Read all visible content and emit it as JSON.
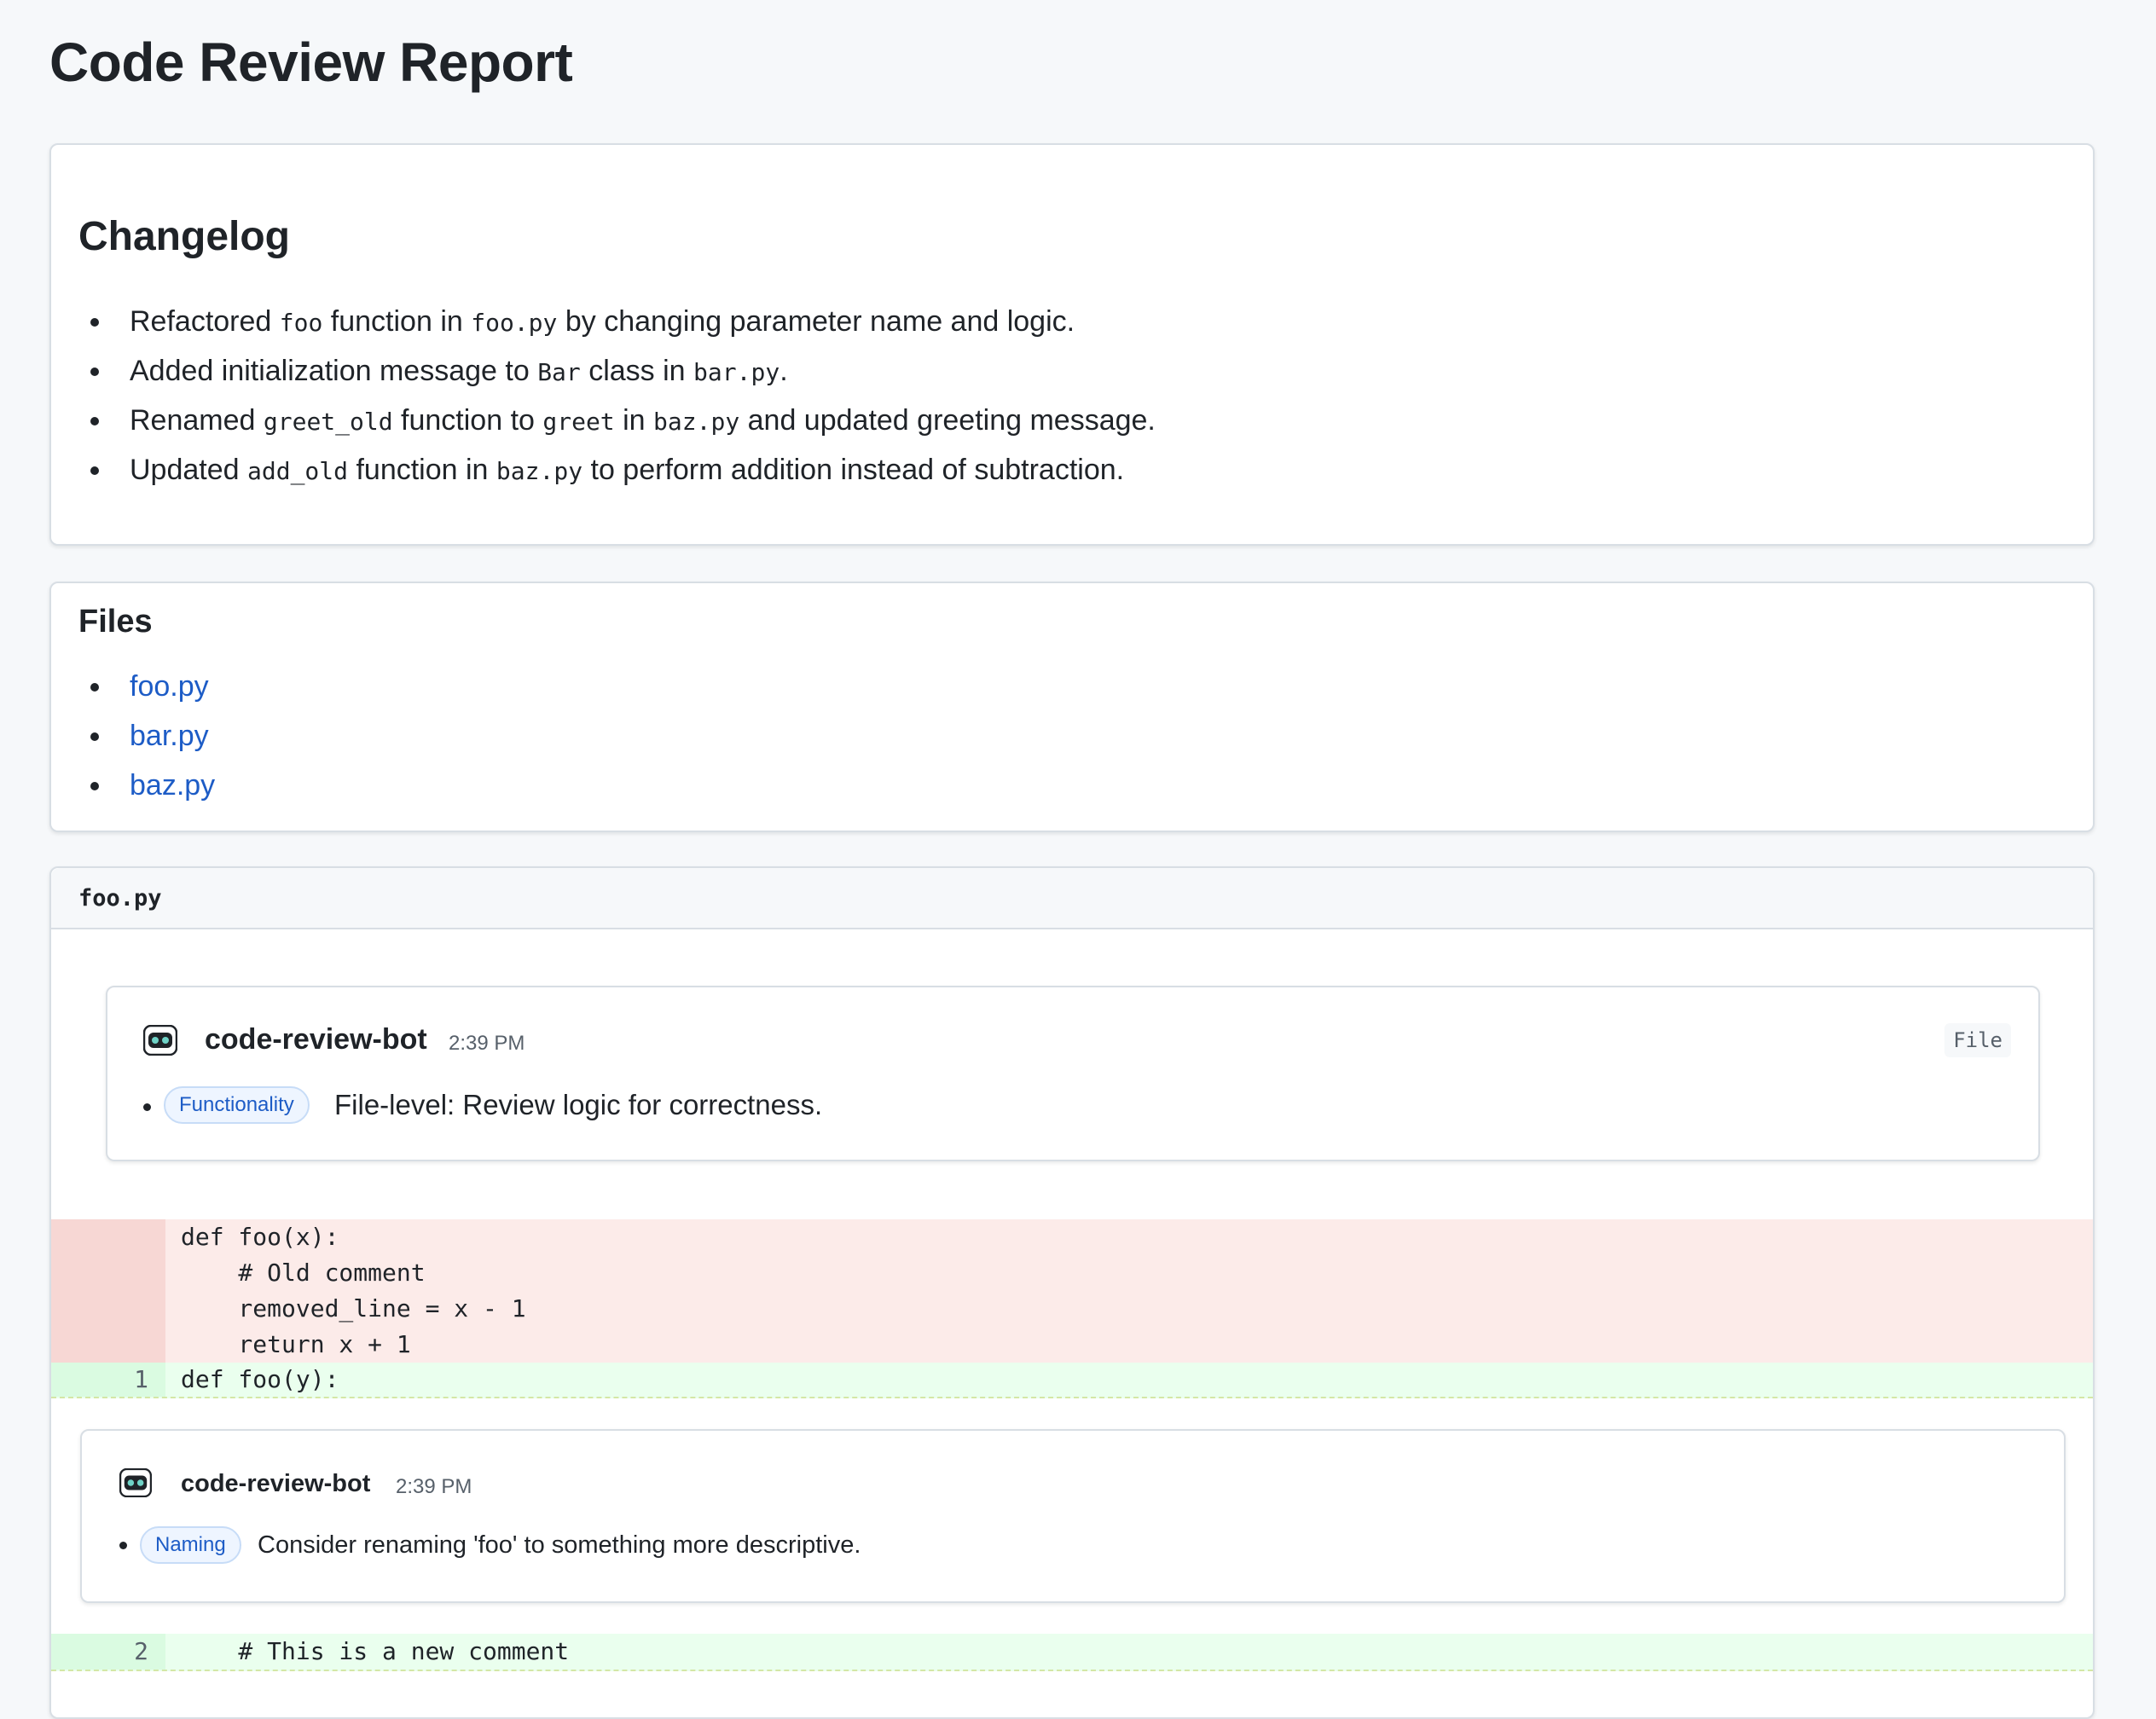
{
  "report": {
    "title": "Code Review Report"
  },
  "changelog": {
    "title": "Changelog",
    "items": [
      {
        "parts": [
          "Refactored ",
          "foo",
          " function in ",
          "foo.py",
          " by changing parameter name and logic."
        ]
      },
      {
        "parts": [
          "Added initialization message to ",
          "Bar",
          " class in ",
          "bar.py",
          "."
        ]
      },
      {
        "parts": [
          "Renamed ",
          "greet_old",
          " function to ",
          "greet",
          " in ",
          "baz.py",
          " and updated greeting message."
        ]
      },
      {
        "parts": [
          "Updated ",
          "add_old",
          " function in ",
          "baz.py",
          " to perform addition instead of subtraction."
        ]
      }
    ]
  },
  "files": {
    "title": "Files",
    "links": [
      "foo.py",
      "bar.py",
      "baz.py"
    ]
  },
  "file_section": {
    "filename": "foo.py",
    "file_comment": {
      "author": "code-review-bot",
      "time": "2:39 PM",
      "scope": "File",
      "tag": "Functionality",
      "text": "File-level: Review logic for correctness."
    },
    "removed_lines": [
      "def foo(x):",
      "    # Old comment",
      "    removed_line = x - 1",
      "    return x + 1"
    ],
    "added_line_1": {
      "number": "1",
      "code": "def foo(y):"
    },
    "line_comment": {
      "author": "code-review-bot",
      "time": "2:39 PM",
      "tag": "Naming",
      "text": "Consider renaming 'foo' to something more descriptive."
    },
    "added_line_2": {
      "number": "2",
      "code": "    # This is a new comment"
    }
  },
  "colors": {
    "link": "#1d5cc6",
    "removed_bg": "#fcebe9",
    "added_bg": "#eaffee",
    "tag_bg": "#eef5ff"
  },
  "icons": {
    "bot": "robot-icon"
  }
}
